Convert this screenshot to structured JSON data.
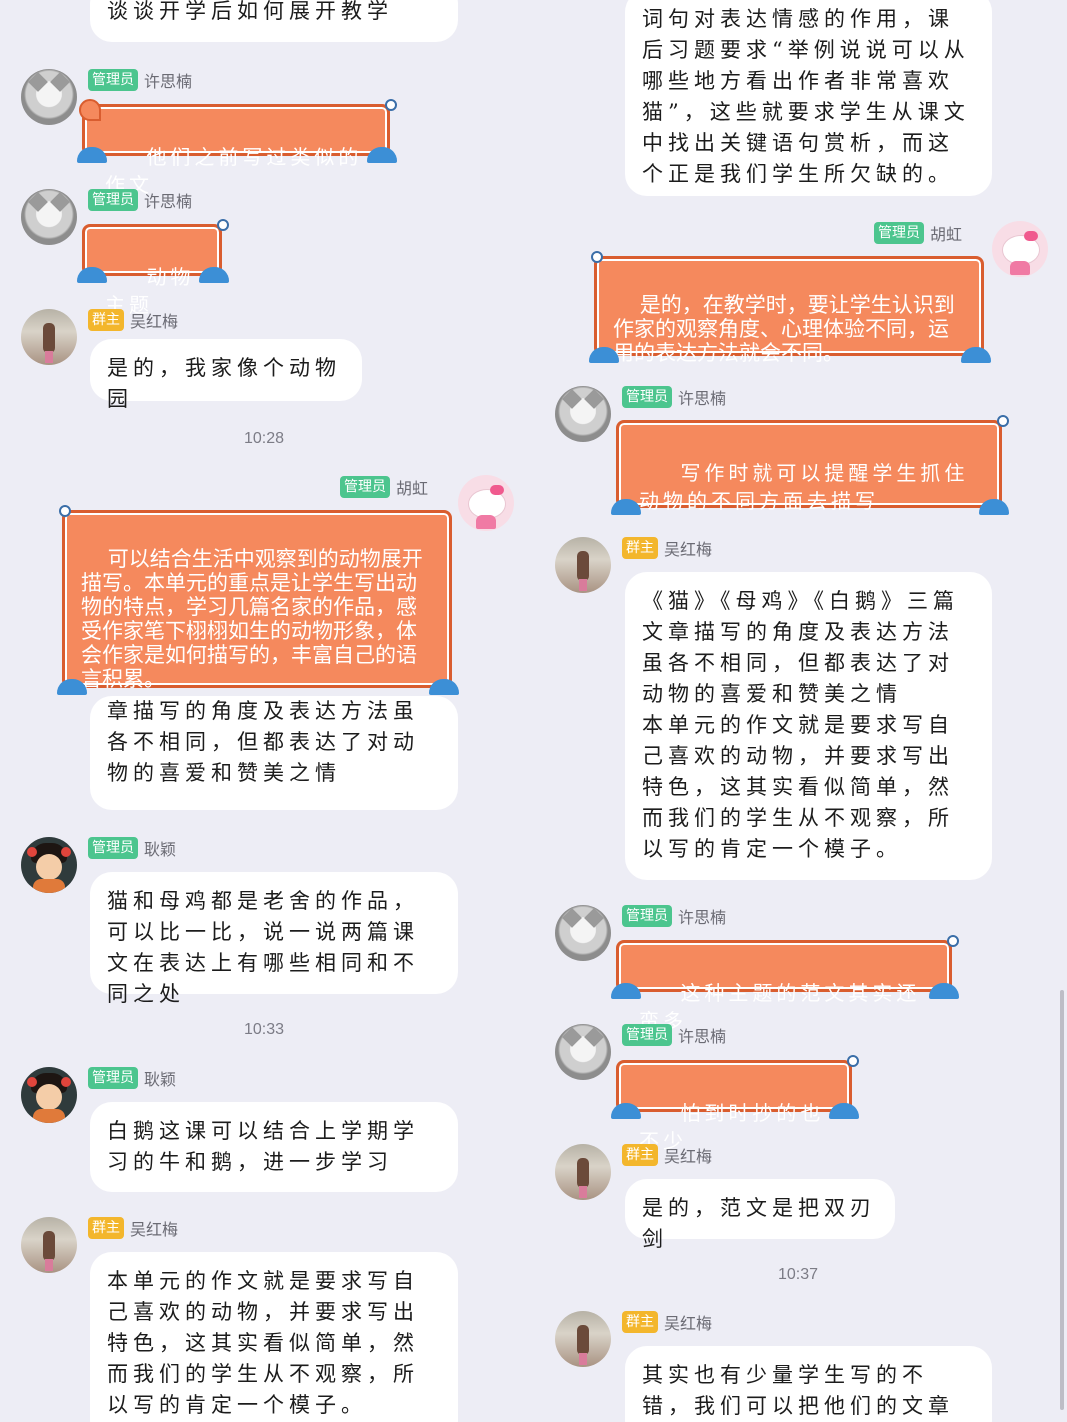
{
  "left": {
    "msg0": {
      "text": "谈谈开学后如何展开教学"
    },
    "msg1": {
      "badge": "管理员",
      "name": "许思楠",
      "text": "他们之前写过类似的作文"
    },
    "msg2": {
      "badge": "管理员",
      "name": "许思楠",
      "text": "动物主题"
    },
    "msg3": {
      "badge": "群主",
      "name": "吴红梅",
      "text": "是的，我家像个动物园"
    },
    "time1": "10:28",
    "msg4": {
      "badge": "管理员",
      "name": "胡虹",
      "text": "可以结合生活中观察到的动物展开描写。本单元的重点是让学生写出动物的特点，学习几篇名家的作品，感受作家笔下栩栩如生的动物形象，体会作家是如何描写的，丰富自己的语言积累。"
    },
    "msg5": {
      "text": "章描写的角度及表达方法虽各不相同，但都表达了对动物的喜爱和赞美之情"
    },
    "msg6": {
      "badge": "管理员",
      "name": "耿颖",
      "text": "猫和母鸡都是老舍的作品，可以比一比，说一说两篇课文在表达上有哪些相同和不同之处"
    },
    "time2": "10:33",
    "msg7": {
      "badge": "管理员",
      "name": "耿颖",
      "text": "白鹅这课可以结合上学期学习的牛和鹅，进一步学习"
    },
    "msg8": {
      "badge": "群主",
      "name": "吴红梅",
      "text": "本单元的作文就是要求写自己喜欢的动物，并要求写出特色，这其实看似简单，然而我们的学生从不观察，所以写的肯定一个模子。"
    }
  },
  "right": {
    "msg0": {
      "text": "词句对表达情感的作用，课后习题要求“举例说说可以从哪些地方看出作者非常喜欢猫”，这些就要求学生从课文中找出关键语句赏析，而这个正是我们学生所欠缺的。"
    },
    "msg1": {
      "badge": "管理员",
      "name": "胡虹",
      "text": "是的，在教学时，要让学生认识到作家的观察角度、心理体验不同，运用的表达方法就会不同。"
    },
    "msg2": {
      "badge": "管理员",
      "name": "许思楠",
      "text": "写作时就可以提醒学生抓住动物的不同方面去描写"
    },
    "msg3": {
      "badge": "群主",
      "name": "吴红梅",
      "text": "《猫》《母鸡》《白鹅》三篇文章描写的角度及表达方法虽各不相同，但都表达了对动物的喜爱和赞美之情\n本单元的作文就是要求写自己喜欢的动物，并要求写出特色，这其实看似简单，然而我们的学生从不观察，所以写的肯定一个模子。"
    },
    "msg4": {
      "badge": "管理员",
      "name": "许思楠",
      "text": "这种主题的范文其实还蛮多"
    },
    "msg5": {
      "badge": "管理员",
      "name": "许思楠",
      "text": "怕到时抄的也不少"
    },
    "msg6": {
      "badge": "群主",
      "name": "吴红梅",
      "text": "是的，范文是把双刃剑"
    },
    "time1": "10:37",
    "msg7": {
      "badge": "群主",
      "name": "吴红梅",
      "text": "其实也有少量学生写的不错，我们可以把他们的文章作范文"
    }
  },
  "colors": {
    "background": "#ededf5",
    "fish_bubble": "#f5895d",
    "admin_badge": "#4cc58e",
    "owner_badge": "#f3b62c"
  },
  "icons": {
    "avatar_cat": "cat-avatar",
    "avatar_girl": "girl-photo-avatar",
    "avatar_cartoon": "cartoon-girl-avatar",
    "avatar_kitty": "hello-kitty-avatar"
  }
}
